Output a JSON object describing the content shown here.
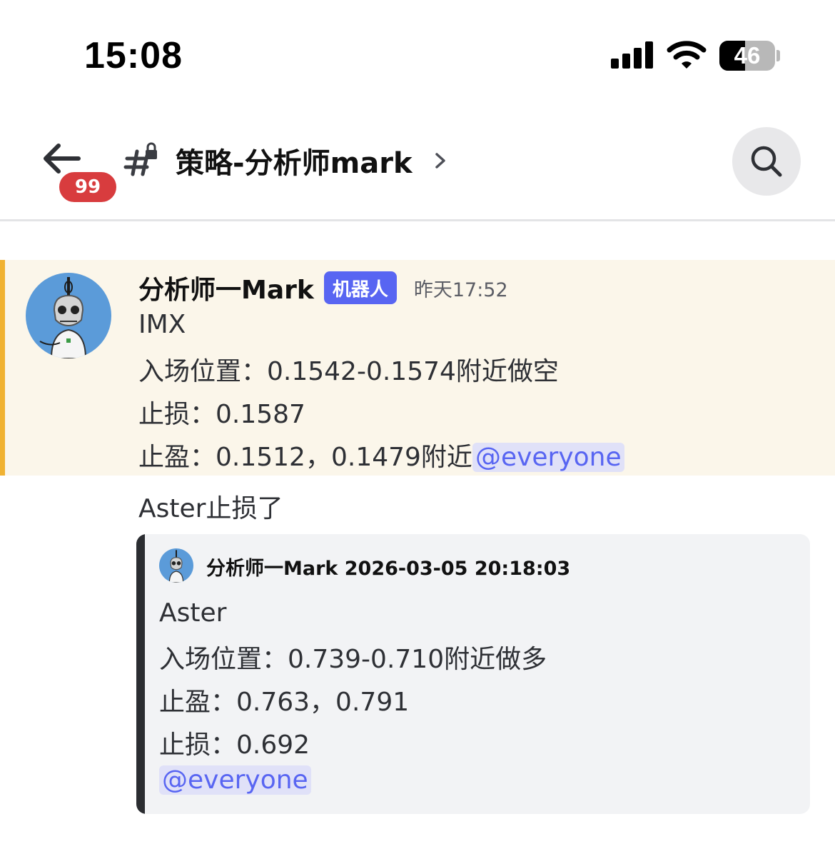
{
  "status_bar": {
    "time": "15:08",
    "battery": "46",
    "battery_level": 0.46
  },
  "header": {
    "unread_count": "99",
    "channel_name": "策略-分析师mark"
  },
  "message": {
    "author": "分析师一Mark",
    "bot_tag": "机器人",
    "timestamp": "昨天17:52",
    "lines": [
      "IMX",
      "入场位置：0.1542-0.1574附近做空",
      "止损：0.1587",
      "止盈：0.1512，0.1479附近"
    ],
    "mention": "@everyone"
  },
  "followup": {
    "text": "Aster止损了"
  },
  "quote": {
    "header": "分析师一Mark 2026-03-05 20:18:03",
    "lines": [
      "Aster",
      "入场位置：0.739-0.710附近做多",
      "止盈：0.763，0.791",
      "止损：0.692"
    ],
    "mention": "@everyone"
  },
  "colors": {
    "highlight_bg": "#fbf6ea",
    "highlight_border": "#f0b232",
    "mention_text": "#5865f2",
    "bot_tag_bg": "#5865f2",
    "badge_bg": "#d83c3e"
  }
}
